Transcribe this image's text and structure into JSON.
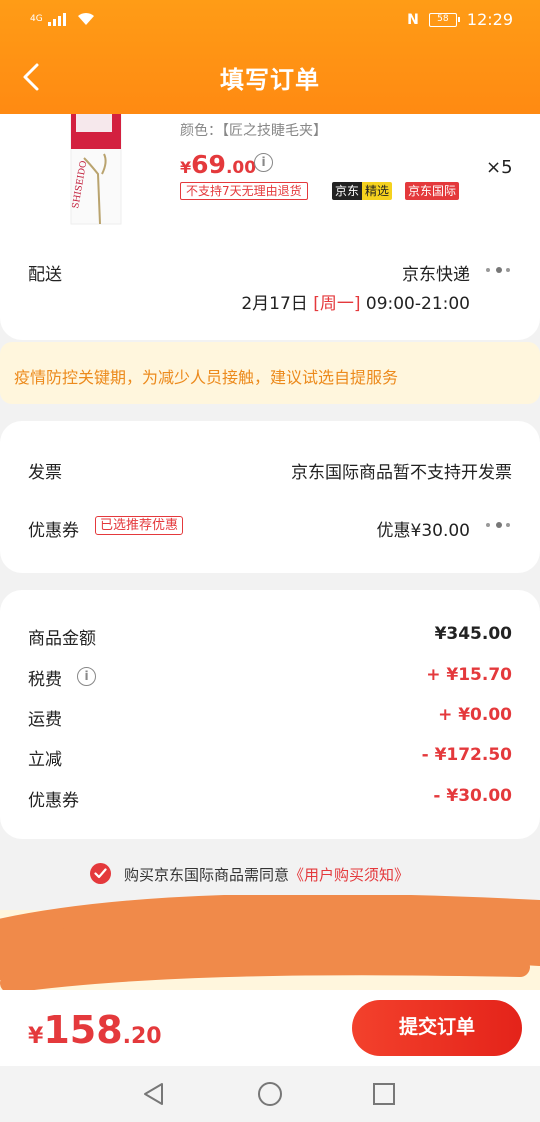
{
  "status_bar": {
    "network": "4G",
    "battery": "58",
    "time": "12:29",
    "nfc": "N"
  },
  "header": {
    "title": "填写订单"
  },
  "product": {
    "color_label": "颜色：【匠之技睫毛夹】",
    "price_yen": "¥",
    "price_int": "69",
    "price_dec": ".00",
    "quantity": "×5",
    "tags": {
      "no_return": "不支持7天无理由退货",
      "jd": "京东",
      "jd_select": "精选",
      "jd_intl": "京东国际"
    }
  },
  "delivery": {
    "label": "配送",
    "method": "京东快递",
    "date": "2月17日",
    "weekday": "[周一]",
    "time": "09:00-21:00"
  },
  "notice": {
    "text": "疫情防控关键期，为减少人员接触，建议试选自提服务"
  },
  "invoice": {
    "label": "发票",
    "value": "京东国际商品暂不支持开发票"
  },
  "coupon": {
    "label": "优惠券",
    "tag": "已选推荐优惠",
    "value": "优惠¥30.00"
  },
  "summary": {
    "items": [
      {
        "label": "商品金额",
        "value": "¥345.00"
      },
      {
        "label": "税费",
        "value": "+ ¥15.70"
      },
      {
        "label": "运费",
        "value": "+ ¥0.00"
      },
      {
        "label": "立减",
        "value": "- ¥172.50"
      },
      {
        "label": "优惠券",
        "value": "- ¥30.00"
      }
    ]
  },
  "agreement": {
    "text": "购买京东国际商品需同意",
    "link": "《用户购买须知》"
  },
  "footer": {
    "total_yen": "¥",
    "total_int": "158",
    "total_dec": ".20",
    "submit_label": "提交订单"
  },
  "colors": {
    "header_orange": "#ff8f14",
    "accent_red": "#e4393c",
    "notice_text": "#ec8a1c",
    "notice_bg": "#fff6dd"
  },
  "icons": {
    "back": "chevron-left-icon",
    "info": "info-circle-icon",
    "more": "more-dots-icon",
    "check": "check-circle-icon",
    "nav_back": "triangle-back-icon",
    "nav_home": "circle-home-icon",
    "nav_recent": "square-recent-icon"
  }
}
